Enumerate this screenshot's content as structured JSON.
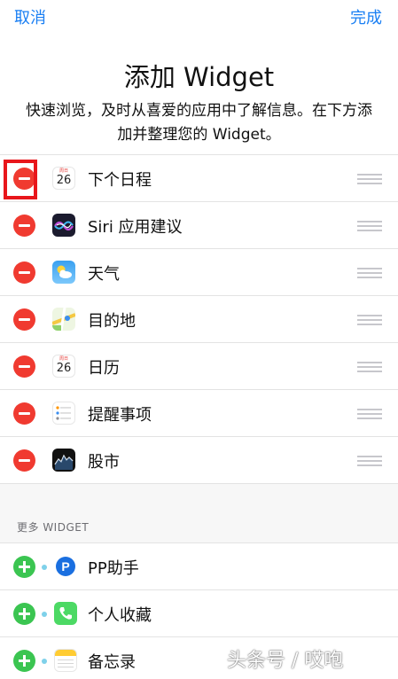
{
  "nav": {
    "cancel": "取消",
    "done": "完成"
  },
  "header": {
    "title": "添加 Widget",
    "subtitle": "快速浏览，及时从喜爱的应用中了解信息。在下方添加并整理您的 Widget。"
  },
  "widgets": [
    {
      "label": "下个日程",
      "icon": "calendar-icon",
      "day": "26"
    },
    {
      "label": "Siri 应用建议",
      "icon": "siri-icon"
    },
    {
      "label": "天气",
      "icon": "weather-icon"
    },
    {
      "label": "目的地",
      "icon": "maps-icon"
    },
    {
      "label": "日历",
      "icon": "calendar-icon",
      "day": "26"
    },
    {
      "label": "提醒事项",
      "icon": "reminders-icon"
    },
    {
      "label": "股市",
      "icon": "stocks-icon"
    }
  ],
  "more": {
    "heading": "更多 WIDGET",
    "items": [
      {
        "label": "PP助手",
        "icon": "pp-assistant-icon"
      },
      {
        "label": "个人收藏",
        "icon": "phone-icon"
      },
      {
        "label": "备忘录",
        "icon": "notes-icon"
      }
    ]
  },
  "watermark": "头条号 / 哎咆",
  "colors": {
    "accent": "#1a7ff3",
    "remove": "#f03a30",
    "add": "#3bc551",
    "highlight": "#e8161b"
  }
}
